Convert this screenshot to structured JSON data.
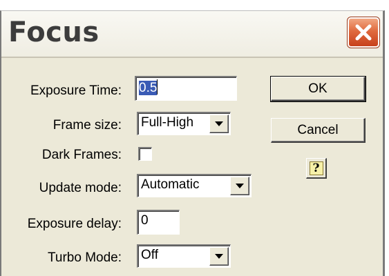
{
  "window": {
    "title": "Focus"
  },
  "form": {
    "exposure_time": {
      "label": "Exposure Time:",
      "value": "0.5"
    },
    "frame_size": {
      "label": "Frame size:",
      "value": "Full-High"
    },
    "dark_frames": {
      "label": "Dark Frames:",
      "checked": false
    },
    "update_mode": {
      "label": "Update mode:",
      "value": "Automatic"
    },
    "exposure_delay": {
      "label": "Exposure delay:",
      "value": "0"
    },
    "turbo_mode": {
      "label": "Turbo Mode:",
      "value": "Off"
    }
  },
  "buttons": {
    "ok_label": "OK",
    "cancel_label": "Cancel",
    "help_glyph": "?"
  },
  "colors": {
    "dialog_bg": "#ece9d8",
    "close_button": "#e06a3e",
    "selection": "#3a5bb5"
  }
}
